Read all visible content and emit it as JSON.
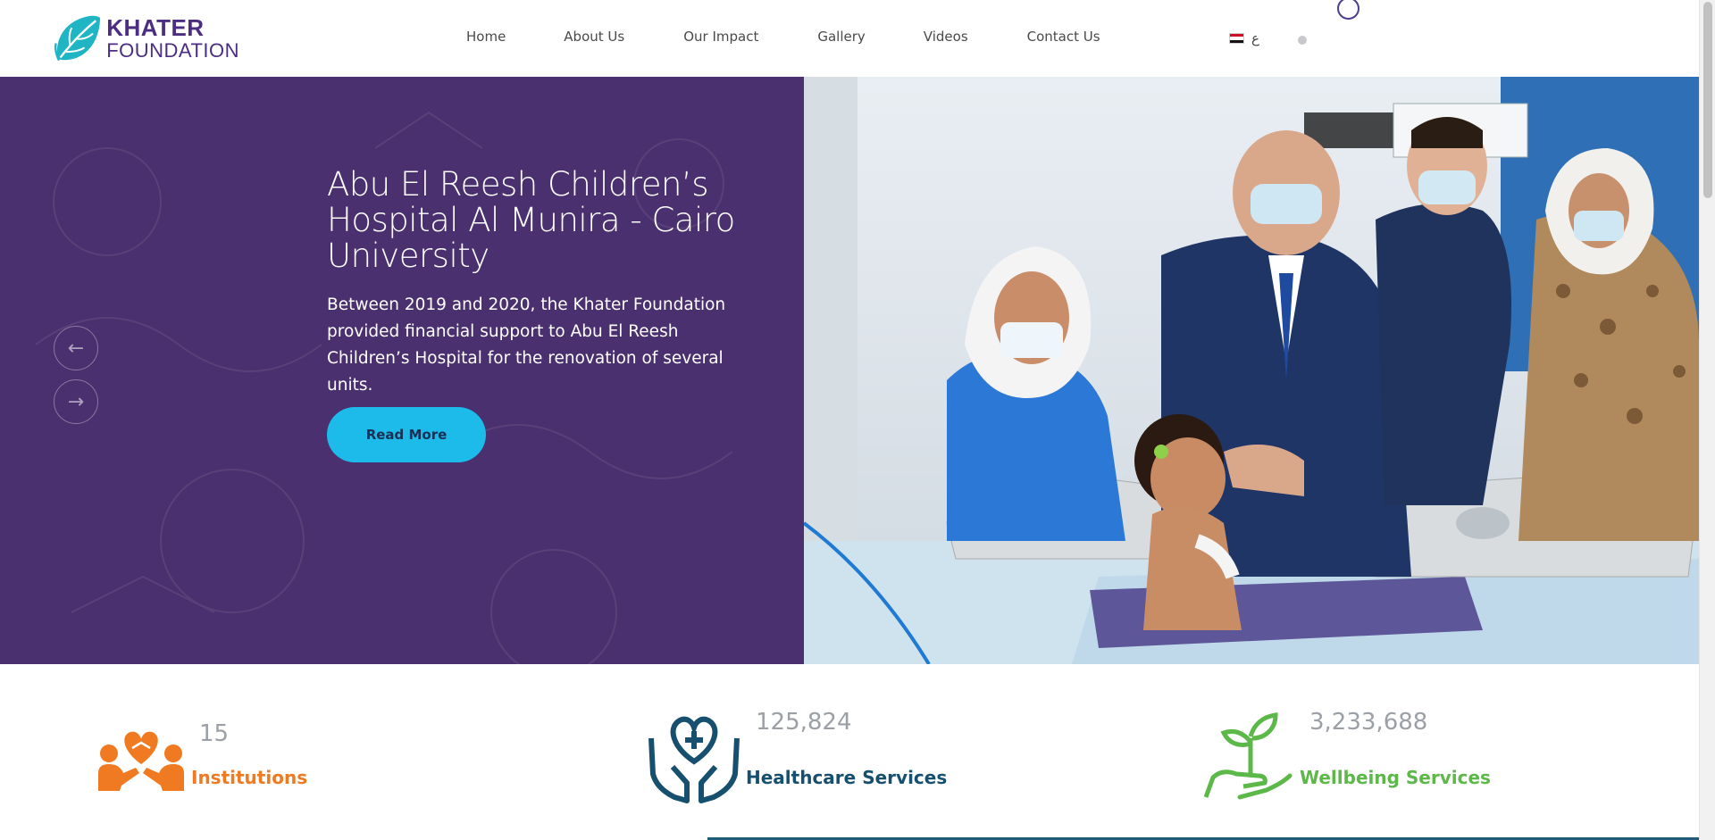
{
  "logo": {
    "line1": "KHATER",
    "line2": "FOUNDATION"
  },
  "nav": {
    "items": [
      "Home",
      "About Us",
      "Our Impact",
      "Gallery",
      "Videos",
      "Contact Us"
    ]
  },
  "lang": {
    "label": "ع",
    "flag": "egypt-flag"
  },
  "hero": {
    "title": "Abu El Reesh Children’s Hospital Al Munira - Cairo University",
    "description": "Between 2019 and 2020, the Khater Foundation provided financial support to Abu El Reesh Children’s Hospital for the renovation of several units.",
    "button": "Read More",
    "prev_icon": "←",
    "next_icon": "→"
  },
  "stats": [
    {
      "value": "15",
      "label": "Institutions",
      "icon": "hands-heart-people-icon",
      "color": "#f07a22"
    },
    {
      "value": "125,824",
      "label": "Healthcare Services",
      "icon": "hands-heart-cross-icon",
      "color": "#17506e"
    },
    {
      "value": "3,233,688",
      "label": "Wellbeing Services",
      "icon": "hand-plant-icon",
      "color": "#5cb848"
    }
  ],
  "colors": {
    "brand_purple": "#4a306e",
    "accent_cyan": "#1dbbe9",
    "logo_teal": "#1fb5c5"
  }
}
